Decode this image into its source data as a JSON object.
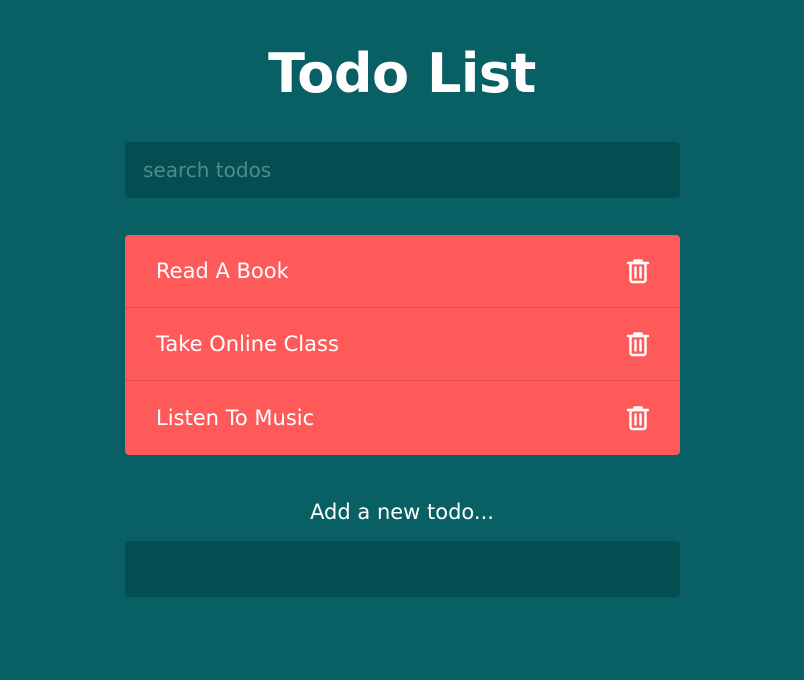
{
  "page": {
    "title": "Todo List"
  },
  "search": {
    "placeholder": "search todos",
    "value": ""
  },
  "todos": [
    {
      "text": "Read A Book",
      "icon": "trash-icon"
    },
    {
      "text": "Take Online Class",
      "icon": "trash-icon"
    },
    {
      "text": "Listen To Music",
      "icon": "trash-icon"
    }
  ],
  "add": {
    "label": "Add a new todo...",
    "value": ""
  },
  "colors": {
    "background": "#086065",
    "input_background": "#044d51",
    "todo_background": "#ff5a5a",
    "text": "#ffffff"
  }
}
